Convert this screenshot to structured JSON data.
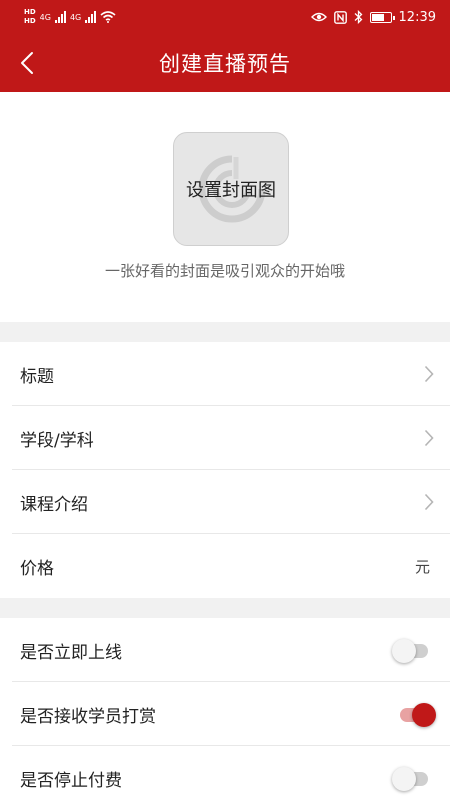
{
  "status_bar": {
    "sim1": "HD",
    "sim2": "HD",
    "net1": "4G",
    "net2": "4G",
    "time": "12:39"
  },
  "header": {
    "title": "创建直播预告",
    "back_icon": "chevron-left-icon"
  },
  "cover": {
    "button_label": "设置封面图",
    "hint": "一张好看的封面是吸引观众的开始哦"
  },
  "form": {
    "title_label": "标题",
    "grade_subject_label": "学段/学科",
    "course_intro_label": "课程介绍",
    "price_label": "价格",
    "price_unit": "元"
  },
  "settings": [
    {
      "label": "是否立即上线",
      "on": false
    },
    {
      "label": "是否接收学员打赏",
      "on": true
    },
    {
      "label": "是否停止付费",
      "on": false
    }
  ],
  "colors": {
    "brand": "#c01818",
    "toggle_on_track": "#e8a2a2",
    "toggle_off_track": "#cfcfcf"
  }
}
